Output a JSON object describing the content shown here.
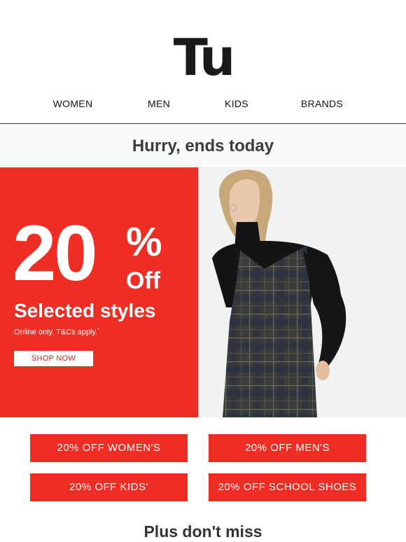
{
  "logo": {
    "text": "Tu"
  },
  "nav": [
    "WOMEN",
    "MEN",
    "KIDS",
    "BRANDS"
  ],
  "banner": {
    "headline": "Hurry, ends today"
  },
  "hero": {
    "number": "20",
    "percent": "%",
    "off": "Off",
    "subtitle": "Selected styles",
    "terms": "Online only. T&Cs apply.",
    "terms_mark": "*",
    "button": "SHOP NOW",
    "brand_color": "#ee2e24"
  },
  "offers": [
    "20% OFF WOMEN'S",
    "20% OFF MEN'S",
    "20% OFF KIDS'",
    "20% OFF SCHOOL SHOES"
  ],
  "footer": {
    "heading": "Plus don't miss"
  }
}
